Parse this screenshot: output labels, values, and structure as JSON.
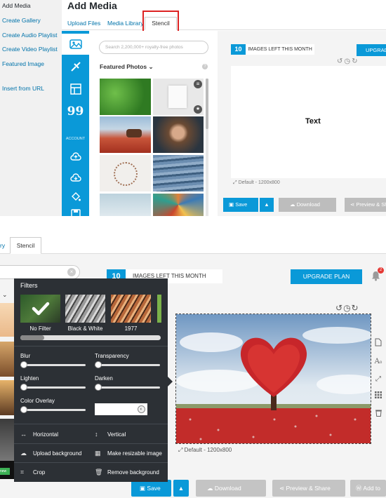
{
  "top": {
    "title": "Add Media",
    "sidebar": [
      "Add Media",
      "Create Gallery",
      "Create Audio Playlist",
      "Create Video Playlist",
      "Featured Image",
      "Insert from URL"
    ],
    "tabs": [
      "Upload Files",
      "Media Library",
      "Stencil"
    ],
    "rail_label": "ACCOUNT",
    "search_placeholder": "Search 2,200,000+ royalty-free photos",
    "featured_label": "Featured Photos",
    "help_glyph": "?",
    "images_left_count": "10",
    "images_left_label": "IMAGES LEFT THIS MONTH",
    "upgrade_label": "UPGRADE PLAN",
    "canvas_text": "Text",
    "canvas_default": "Default - 1200x800",
    "save_label": "Save",
    "download_label": "Download",
    "preview_label": "Preview & Share"
  },
  "bottom": {
    "tabs": [
      "ry",
      "Stencil"
    ],
    "search_clear": "×",
    "new_badge": "new",
    "images_left_count": "10",
    "images_left_label": "IMAGES LEFT THIS MONTH",
    "upgrade_label": "UPGRADE PLAN",
    "notification_count": "2",
    "canvas_default": "Default - 1200x800",
    "save_label": "Save",
    "download_label": "Download",
    "preview_label": "Preview & Share",
    "addto_label": "Add to"
  },
  "filters": {
    "title": "Filters",
    "presets": [
      "No Filter",
      "Black & White",
      "1977"
    ],
    "sliders": [
      "Blur",
      "Transparency",
      "Lighten",
      "Darken",
      "Color Overlay"
    ],
    "actions": [
      "Horizontal",
      "Vertical",
      "Upload background",
      "Make resizable image",
      "Crop",
      "Remove background"
    ]
  },
  "colors": {
    "accent": "#0a99d8",
    "panel_dark": "#2c3035",
    "highlight_red": "#dd2222",
    "link": "#0073aa"
  }
}
